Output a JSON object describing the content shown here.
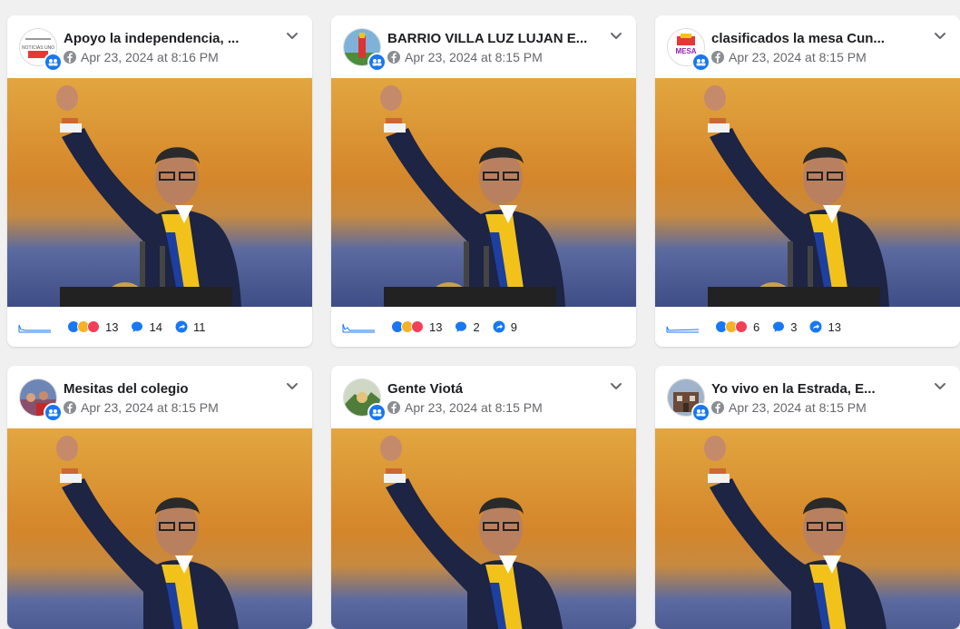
{
  "colors": {
    "accent": "#1877f2",
    "muted": "#65676b",
    "text": "#1c1e21",
    "background": "#f0f0f0"
  },
  "posts": [
    {
      "title": "Apoyo la independencia, ...",
      "date": "Apr 23, 2024 at 8:16 PM",
      "reactions": "13",
      "comments": "14",
      "shares": "11",
      "avatar_icon": "avatar-logo-noticias-uno",
      "avatar_text": "NOTICIAS UNO"
    },
    {
      "title": "BARRIO VILLA LUZ LUJAN E...",
      "date": "Apr 23, 2024 at 8:15 PM",
      "reactions": "13",
      "comments": "2",
      "shares": "9",
      "avatar_icon": "avatar-flag-tower"
    },
    {
      "title": "clasificados la mesa Cun...",
      "date": "Apr 23, 2024 at 8:15 PM",
      "reactions": "6",
      "comments": "3",
      "shares": "13",
      "avatar_icon": "avatar-logo-la-mesa",
      "avatar_text": "MESA"
    },
    {
      "title": "Mesitas del colegio",
      "date": "Apr 23, 2024 at 8:15 PM",
      "avatar_icon": "avatar-photo-crowd"
    },
    {
      "title": "Gente Viotá",
      "date": "Apr 23, 2024 at 8:15 PM",
      "avatar_icon": "avatar-photo-landscape"
    },
    {
      "title": "Yo vivo en la Estrada, E...",
      "date": "Apr 23, 2024 at 8:15 PM",
      "avatar_icon": "avatar-photo-building"
    }
  ]
}
